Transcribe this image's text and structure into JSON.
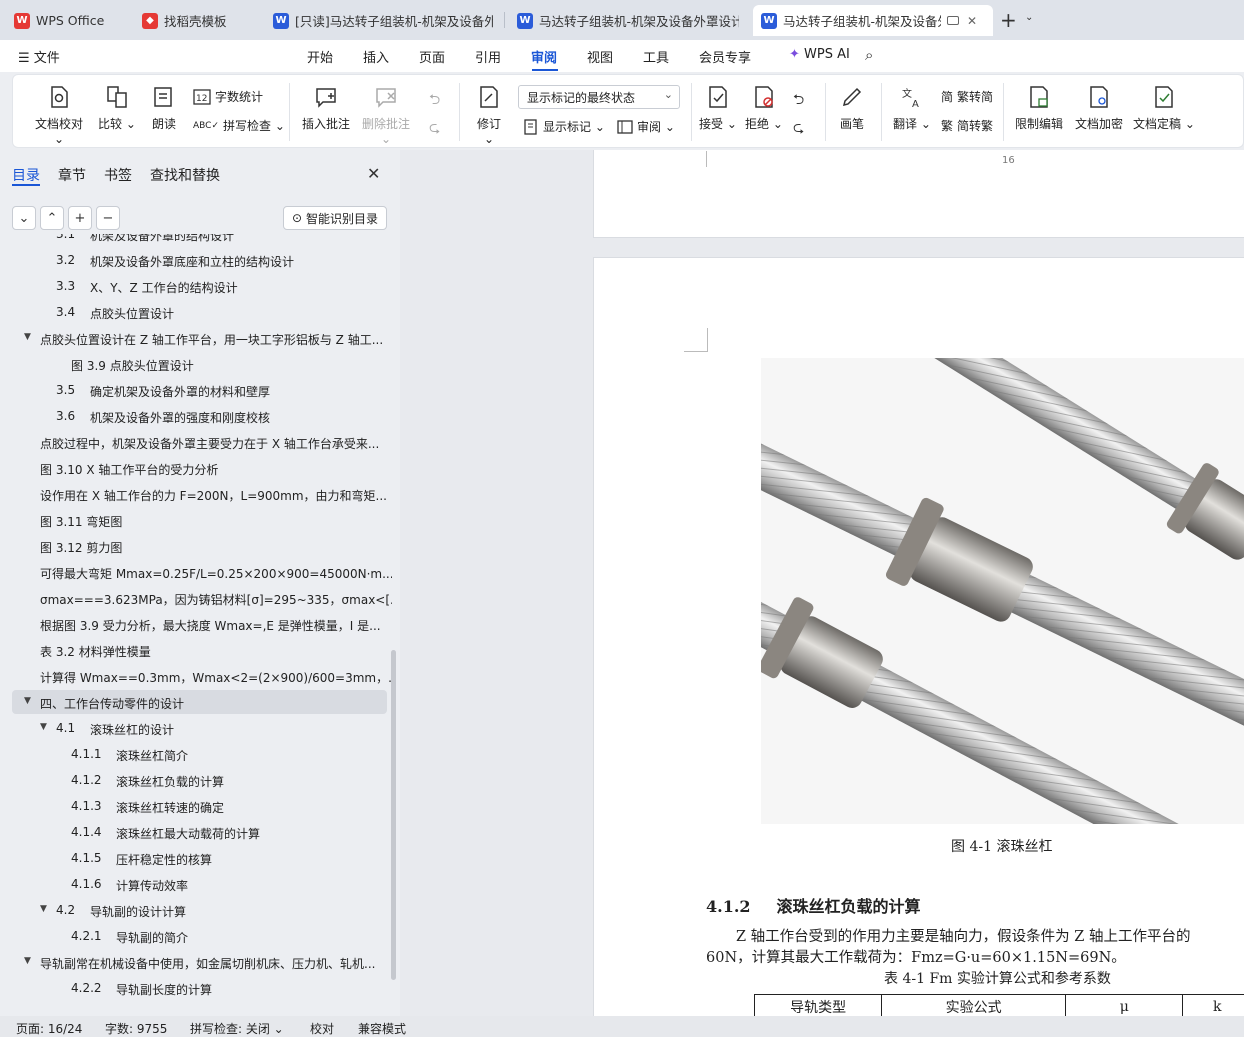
{
  "tabs": [
    {
      "label": "WPS Office",
      "icon_color": "#e53935",
      "icon": "W"
    },
    {
      "label": "找稻壳模板",
      "icon_color": "#e53935",
      "icon": "稻"
    },
    {
      "label": "[只读]马达转子组装机-机架及设备外罩",
      "icon_color": "#2b5cd9",
      "icon": "W"
    },
    {
      "label": "马达转子组装机-机架及设备外罩设计",
      "icon_color": "#2b5cd9",
      "icon": "W"
    },
    {
      "label": "马达转子组装机-机架及设备外",
      "icon_color": "#2b5cd9",
      "icon": "W",
      "active": true
    }
  ],
  "menubar": {
    "file": "文件",
    "items": [
      "开始",
      "插入",
      "页面",
      "引用",
      "审阅",
      "视图",
      "工具",
      "会员专享"
    ],
    "active": "审阅",
    "wps_ai": "WPS AI"
  },
  "ribbon": {
    "doc_check": "文档校对",
    "compare": "比较",
    "read_aloud": "朗读",
    "word_count": "字数统计",
    "spell_check": "拼写检查",
    "insert_comment": "插入批注",
    "delete_comment": "删除批注",
    "revise": "修订",
    "markup_state": "显示标记的最终状态",
    "show_markup": "显示标记",
    "review": "审阅",
    "accept": "接受",
    "reject": "拒绝",
    "pen": "画笔",
    "translate": "翻译",
    "trad_to_simp": "繁转简",
    "simp_to_trad": "简转繁",
    "restrict_edit": "限制编辑",
    "encrypt": "文档加密",
    "finalize": "文档定稿",
    "accent_color": "#1a56d6"
  },
  "sidebar": {
    "tabs": [
      "目录",
      "章节",
      "书签",
      "查找和替换"
    ],
    "smart_toc": "智能识别目录",
    "toc": [
      {
        "num": "3.1",
        "text": "机架及设备外罩的结构设计",
        "level": 2
      },
      {
        "num": "3.2",
        "text": "机架及设备外罩底座和立柱的结构设计",
        "level": 2
      },
      {
        "num": "3.3",
        "text": "X、Y、Z 工作台的结构设计",
        "level": 2
      },
      {
        "num": "3.4",
        "text": "点胶头位置设计",
        "level": 2
      },
      {
        "num": "",
        "text": "点胶头位置设计在 Z 轴工作平台，用一块工字形铝板与 Z 轴工...",
        "level": 1,
        "expanded": true
      },
      {
        "num": "",
        "text": "图 3.9  点胶头位置设计",
        "level": 3
      },
      {
        "num": "3.5",
        "text": "确定机架及设备外罩的材料和壁厚",
        "level": 2
      },
      {
        "num": "3.6",
        "text": "机架及设备外罩的强度和刚度校核",
        "level": 2
      },
      {
        "num": "",
        "text": "点胶过程中，机架及设备外罩主要受力在于 X 轴工作台承受来...",
        "level": 1
      },
      {
        "num": "",
        "text": "图 3.10 X 轴工作平台的受力分析",
        "level": 1
      },
      {
        "num": "",
        "text": "设作用在 X 轴工作台的力 F=200N，L=900mm，由力和弯矩...",
        "level": 1
      },
      {
        "num": "",
        "text": "图 3.11  弯矩图",
        "level": 1
      },
      {
        "num": "",
        "text": "图 3.12  剪力图",
        "level": 1
      },
      {
        "num": "",
        "text": "可得最大弯矩 Mmax=0.25F/L=0.25×200×900=45000N·m...",
        "level": 1
      },
      {
        "num": "",
        "text": "σmax===3.623MPa，因为铸铝材料[σ]=295~335，σmax<[...",
        "level": 1
      },
      {
        "num": "",
        "text": "根据图 3.9 受力分析，最大挠度 Wmax=,E 是弹性模量，I 是...",
        "level": 1
      },
      {
        "num": "",
        "text": "表 3.2  材料弹性模量",
        "level": 1
      },
      {
        "num": "",
        "text": "计算得 Wmax==0.3mm，Wmax<2=(2×900)/600=3mm，...",
        "level": 1
      },
      {
        "num": "",
        "text": "四、工作台传动零件的设计",
        "level": 1,
        "expanded": true,
        "selected": true
      },
      {
        "num": "4.1",
        "text": "滚珠丝杠的设计",
        "level": 2,
        "expanded": true
      },
      {
        "num": "4.1.1",
        "text": "滚珠丝杠简介",
        "level": 3
      },
      {
        "num": "4.1.2",
        "text": "滚珠丝杠负载的计算",
        "level": 3
      },
      {
        "num": "4.1.3",
        "text": "滚珠丝杠转速的确定",
        "level": 3
      },
      {
        "num": "4.1.4",
        "text": "滚珠丝杠最大动载荷的计算",
        "level": 3
      },
      {
        "num": "4.1.5",
        "text": "压杆稳定性的核算",
        "level": 3
      },
      {
        "num": "4.1.6",
        "text": "计算传动效率",
        "level": 3
      },
      {
        "num": "4.2",
        "text": "导轨副的设计计算",
        "level": 2,
        "expanded": true
      },
      {
        "num": "4.2.1",
        "text": "导轨副的简介",
        "level": 3
      },
      {
        "num": "",
        "text": "导轨副常在机械设备中使用，如金属切削机床、压力机、轧机...",
        "level": 1,
        "expanded": true
      },
      {
        "num": "4.2.2",
        "text": "导轨副长度的计算",
        "level": 3
      }
    ]
  },
  "document": {
    "page_number": "16",
    "figure_caption": "图 4-1  滚珠丝杠",
    "heading_num": "4.1.2",
    "heading_text": "滚珠丝杠负载的计算",
    "para_line1": "Z 轴工作台受到的作用力主要是轴向力，假设条件为 Z 轴上工作平台的",
    "para_line2": "60N，计算其最大工作载荷为：Fmz=G·u=60×1.15N=69N。",
    "table_caption": "表  4-1 Fm 实验计算公式和参考系数",
    "table_headers": [
      "导轨类型",
      "实验公式",
      "μ",
      "k"
    ]
  },
  "statusbar": {
    "page": "页面: 16/24",
    "words": "字数: 9755",
    "spell": "拼写检查: 关闭",
    "proof": "校对",
    "compat": "兼容模式"
  }
}
